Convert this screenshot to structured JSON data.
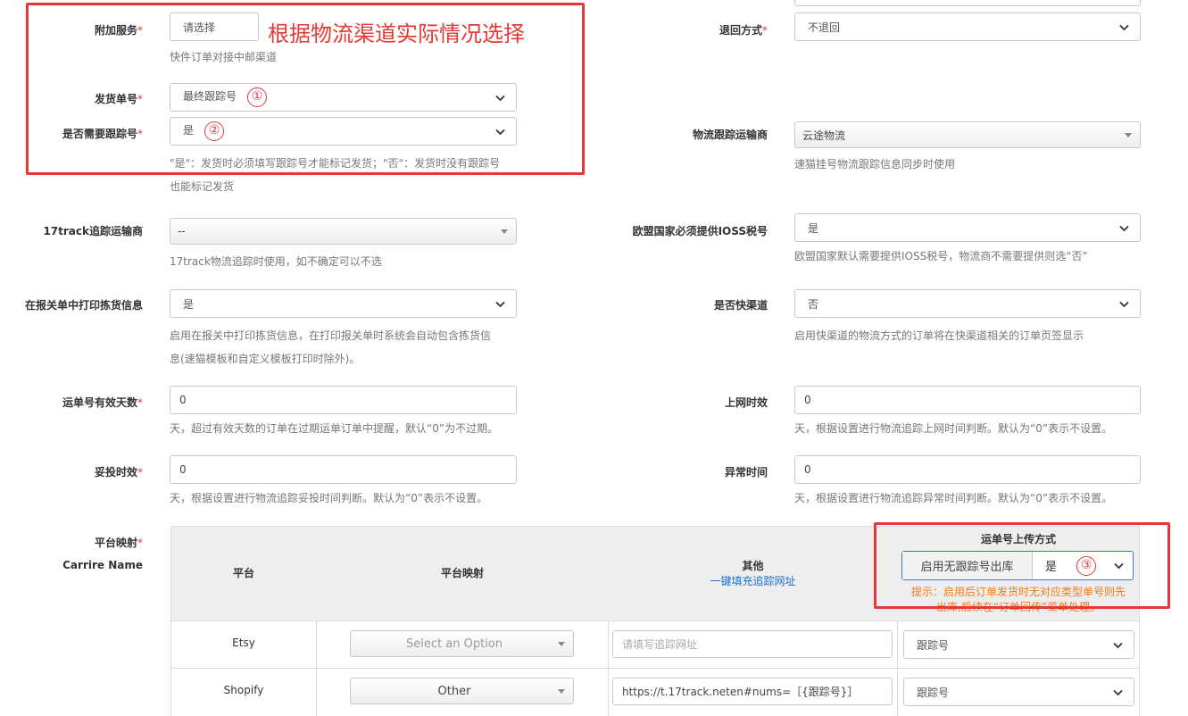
{
  "annotation": {
    "title": "根据物流渠道实际情况选择",
    "marker1": "①",
    "marker2": "②",
    "marker3": "③"
  },
  "left": {
    "addon": {
      "label": "附加服务",
      "value": "请选择",
      "hint": "快件订单对接中邮渠道"
    },
    "ship_no": {
      "label": "发货单号",
      "value": "最终跟踪号"
    },
    "need_tracking": {
      "label": "是否需要跟踪号",
      "value": "是",
      "hint1": "\"是\"：发货时必须填写跟踪号才能标记发货；\"否\"：发货时没有跟踪号",
      "hint2": "也能标记发货"
    },
    "track17": {
      "label": "17track追踪运输商",
      "value": "--",
      "hint": "17track物流追踪时使用，如不确定可以不选"
    },
    "print_picking": {
      "label": "在报关单中打印拣货信息",
      "value": "是",
      "hint1": "启用在报关中打印拣货信息，在打印报关单时系统会自动包含拣货信",
      "hint2": "息(速猫模板和自定义模板打印时除外)。"
    },
    "valid_days": {
      "label": "运单号有效天数",
      "value": "0",
      "hint": "天，超过有效天数的订单在过期运单订单中提醒，默认“0”为不过期。"
    },
    "delivery_time": {
      "label": "妥投时效",
      "value": "0",
      "hint": "天，根据设置进行物流追踪妥投时间判断。默认为“0”表示不设置。"
    },
    "platform_map": {
      "label": "平台映射",
      "sublabel": "Carrire Name"
    }
  },
  "right": {
    "return": {
      "label": "退回方式",
      "value": "不退回"
    },
    "carrier": {
      "label": "物流跟踪运输商",
      "value": "云途物流",
      "hint": "速猫挂号物流跟踪信息同步时使用"
    },
    "ioss": {
      "label": "欧盟国家必须提供IOSS税号",
      "value": "是",
      "hint": "欧盟国家默认需要提供IOSS税号，物流商不需要提供则选“否”"
    },
    "fast_channel": {
      "label": "是否快渠道",
      "value": "否",
      "hint": "启用快渠道的物流方式的订单将在快渠道相关的订单页签显示"
    },
    "online_time": {
      "label": "上网时效",
      "value": "0",
      "hint": "天，根据设置进行物流追踪上网时间判断。默认为“0”表示不设置。"
    },
    "abnormal_time": {
      "label": "异常时间",
      "value": "0",
      "hint": "天，根据设置进行物流追踪异常时间判断。默认为“0”表示不设置。"
    }
  },
  "table": {
    "col_platform": "平台",
    "col_mapping": "平台映射",
    "col_other": "其他",
    "fill_link": "一键填充追踪网址",
    "col_upload": "运单号上传方式",
    "no_track_label": "启用无跟踪号出库",
    "no_track_value": "是",
    "tip1": "提示：启用后订单发货时无对应类型单号则先",
    "tip2": "出库,后续在“订单回传”菜单处理。",
    "rows": [
      {
        "platform": "Etsy",
        "mapping": "Select an Option",
        "url": "",
        "url_placeholder": "请填写追踪网址",
        "upload": "跟踪号"
      },
      {
        "platform": "Shopify",
        "mapping": "Other",
        "url": "https://t.17track.neten#nums=［{跟踪号}］",
        "url_placeholder": "",
        "upload": "跟踪号"
      }
    ]
  },
  "colors": {
    "required": "#e0393e",
    "annotation": "#e53935",
    "link": "#1a6fd1",
    "tip": "#f07b18"
  }
}
